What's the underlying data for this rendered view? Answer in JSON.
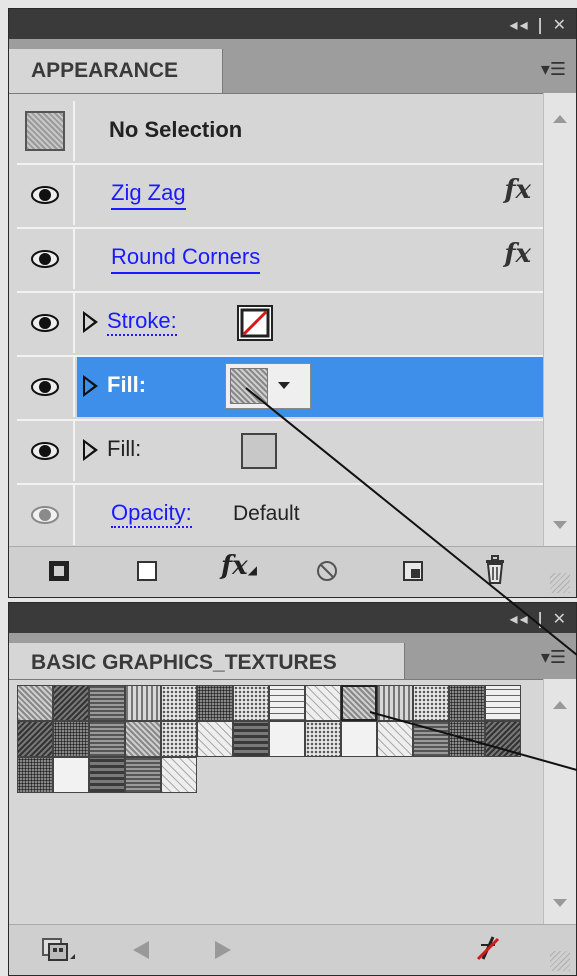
{
  "appearance_panel": {
    "tab_title": "APPEARANCE",
    "header_label": "No Selection",
    "rows": [
      {
        "label": "Zig Zag",
        "effect_icon": "fx-icon",
        "visible": true
      },
      {
        "label": "Round Corners",
        "effect_icon": "fx-icon",
        "visible": true
      },
      {
        "label": "Stroke:",
        "swatch": "none-swatch",
        "visible": true
      },
      {
        "label": "Fill:",
        "swatch": "texture-swatch",
        "selected": true,
        "visible": true
      },
      {
        "label": "Fill:",
        "swatch": "gray-swatch",
        "visible": true
      },
      {
        "label": "Opacity:",
        "value": "Default",
        "visible": false
      }
    ],
    "toolbar_icons": [
      "add-new-stroke-icon",
      "add-new-fill-icon",
      "add-new-effect-icon",
      "clear-appearance-icon",
      "duplicate-item-icon",
      "delete-item-icon"
    ]
  },
  "swatches_panel": {
    "tab_title": "BASIC GRAPHICS_TEXTURES",
    "swatch_count": 32,
    "toolbar_icons": [
      "swatch-libraries-menu-icon",
      "previous-library-icon",
      "next-library-icon",
      "none-swatch-icon"
    ]
  },
  "colors": {
    "selection_highlight": "#3d8fe9",
    "link_text": "#1a1aff",
    "titlebar": "#3a3a3a",
    "panel_bg": "#d6d6d6"
  }
}
